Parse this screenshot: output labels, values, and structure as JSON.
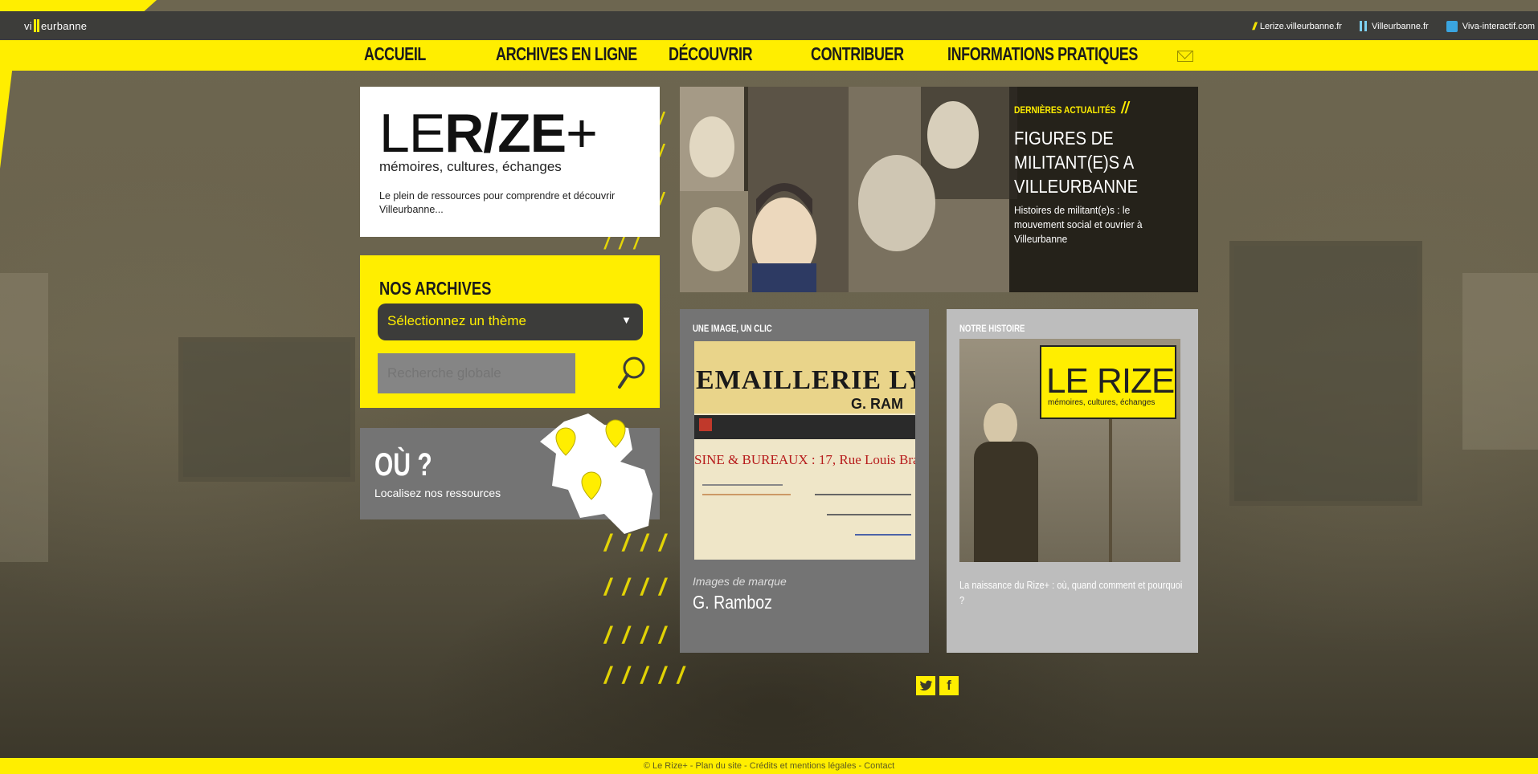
{
  "topbar": {
    "logo": "villeurbanne",
    "links": [
      "Lerize.villeurbanne.fr",
      "Villeurbanne.fr",
      "Viva-interactif.com"
    ]
  },
  "nav": {
    "items": [
      "ACCUEIL",
      "ARCHIVES EN LIGNE",
      "DÉCOUVRIR",
      "CONTRIBUER",
      "INFORMATIONS PRATIQUES"
    ]
  },
  "hero": {
    "logo_le": "LE",
    "logo_rize": "R/ZE",
    "logo_plus": "+",
    "tagline": "mémoires, cultures, échanges",
    "description": "Le plein de ressources pour comprendre et découvrir Villeurbanne..."
  },
  "archives": {
    "title": "NOS ARCHIVES",
    "theme_select": "Sélectionnez un thème",
    "search_placeholder": "Recherche globale"
  },
  "ou": {
    "title": "OÙ ?",
    "subtitle": "Localisez nos ressources"
  },
  "news": {
    "label": "DERNIÈRES ACTUALITÉS",
    "title": "FIGURES DE MILITANT(E)S A VILLEURBANNE",
    "title_lines": [
      "FIGURES DE",
      "MILITANT(E)S A",
      "VILLEURBANNE"
    ],
    "description": "Histoires de militant(e)s : le mouvement social et ouvrier à Villeurbanne"
  },
  "image_card": {
    "label": "UNE IMAGE, UN CLIC",
    "picture_header": "EMAILLERIE LY",
    "picture_name": "G. RAM",
    "picture_address": "SINE & BUREAUX : 17, Rue Louis Brai",
    "category": "Images de marque",
    "title": "G. Ramboz"
  },
  "history_card": {
    "label": "NOTRE HISTOIRE",
    "sign_text": "LE RIZE",
    "sign_tagline": "mémoires, cultures, échanges",
    "description": "La naissance du Rize+ : où, quand comment et pourquoi ?"
  },
  "social": {
    "twitter_icon": "twitter-icon",
    "facebook_icon": "facebook-icon"
  },
  "footer": {
    "text": "© Le Rize+ - Plan du site - Crédits et mentions légales - Contact"
  },
  "colors": {
    "brand_yellow": "#ffee00",
    "dark_bar": "#3d3d3a",
    "card_grey": "#747474",
    "card_light_grey": "#bdbdbd"
  }
}
